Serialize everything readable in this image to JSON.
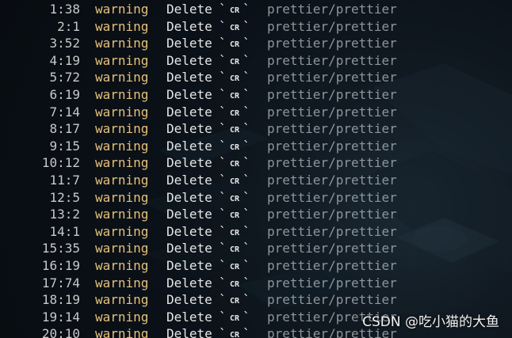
{
  "colors": {
    "severity": "#e5c07b",
    "message": "#e7e7e7",
    "rule": "#8e969c",
    "position": "#c8c8c8",
    "background": "#0b1118"
  },
  "lint_output": [
    {
      "position": "1:38",
      "severity": "warning",
      "message": "Delete",
      "token": "CR",
      "rule": "prettier/prettier"
    },
    {
      "position": "2:1",
      "severity": "warning",
      "message": "Delete",
      "token": "CR",
      "rule": "prettier/prettier"
    },
    {
      "position": "3:52",
      "severity": "warning",
      "message": "Delete",
      "token": "CR",
      "rule": "prettier/prettier"
    },
    {
      "position": "4:19",
      "severity": "warning",
      "message": "Delete",
      "token": "CR",
      "rule": "prettier/prettier"
    },
    {
      "position": "5:72",
      "severity": "warning",
      "message": "Delete",
      "token": "CR",
      "rule": "prettier/prettier"
    },
    {
      "position": "6:19",
      "severity": "warning",
      "message": "Delete",
      "token": "CR",
      "rule": "prettier/prettier"
    },
    {
      "position": "7:14",
      "severity": "warning",
      "message": "Delete",
      "token": "CR",
      "rule": "prettier/prettier"
    },
    {
      "position": "8:17",
      "severity": "warning",
      "message": "Delete",
      "token": "CR",
      "rule": "prettier/prettier"
    },
    {
      "position": "9:15",
      "severity": "warning",
      "message": "Delete",
      "token": "CR",
      "rule": "prettier/prettier"
    },
    {
      "position": "10:12",
      "severity": "warning",
      "message": "Delete",
      "token": "CR",
      "rule": "prettier/prettier"
    },
    {
      "position": "11:7",
      "severity": "warning",
      "message": "Delete",
      "token": "CR",
      "rule": "prettier/prettier"
    },
    {
      "position": "12:5",
      "severity": "warning",
      "message": "Delete",
      "token": "CR",
      "rule": "prettier/prettier"
    },
    {
      "position": "13:2",
      "severity": "warning",
      "message": "Delete",
      "token": "CR",
      "rule": "prettier/prettier"
    },
    {
      "position": "14:1",
      "severity": "warning",
      "message": "Delete",
      "token": "CR",
      "rule": "prettier/prettier"
    },
    {
      "position": "15:35",
      "severity": "warning",
      "message": "Delete",
      "token": "CR",
      "rule": "prettier/prettier"
    },
    {
      "position": "16:19",
      "severity": "warning",
      "message": "Delete",
      "token": "CR",
      "rule": "prettier/prettier"
    },
    {
      "position": "17:74",
      "severity": "warning",
      "message": "Delete",
      "token": "CR",
      "rule": "prettier/prettier"
    },
    {
      "position": "18:19",
      "severity": "warning",
      "message": "Delete",
      "token": "CR",
      "rule": "prettier/prettier"
    },
    {
      "position": "19:14",
      "severity": "warning",
      "message": "Delete",
      "token": "CR",
      "rule": "prettier/prettier"
    },
    {
      "position": "20:10",
      "severity": "warning",
      "message": "Delete",
      "token": "CR",
      "rule": "prettier/prettier"
    }
  ],
  "watermark": "CSDN @吃小猫的大鱼"
}
